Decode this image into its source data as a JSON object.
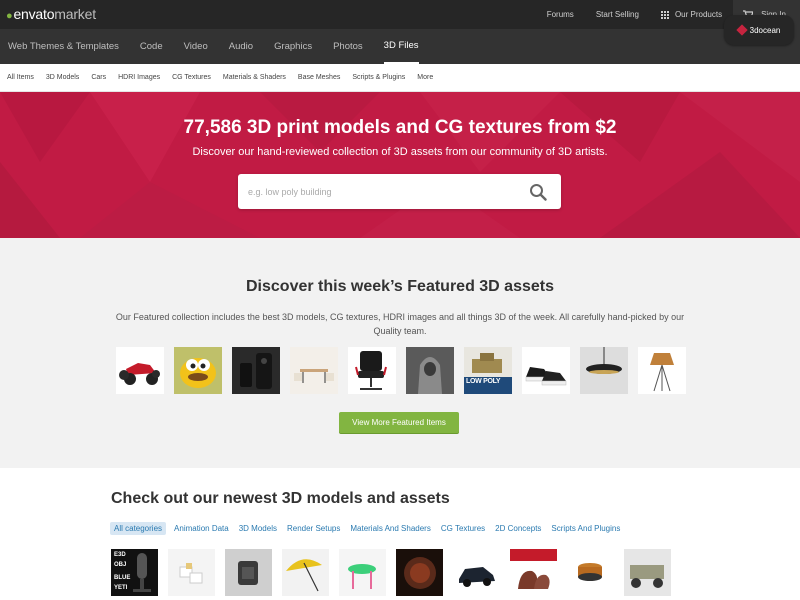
{
  "topbar": {
    "logo_main": "envato",
    "logo_sub": "market",
    "links": [
      "Forums",
      "Start Selling",
      "Our Products",
      "Sign In"
    ]
  },
  "catnav": {
    "items": [
      "Web Themes & Templates",
      "Code",
      "Video",
      "Audio",
      "Graphics",
      "Photos",
      "3D Files"
    ],
    "active": "3D Files",
    "brand": "3docean"
  },
  "subnav": {
    "items": [
      "All Items",
      "3D Models",
      "Cars",
      "HDRI Images",
      "CG Textures",
      "Materials & Shaders",
      "Base Meshes",
      "Scripts & Plugins",
      "More"
    ]
  },
  "hero": {
    "title": "77,586 3D print models and CG textures from $2",
    "subtitle": "Discover our hand-reviewed collection of 3D assets from our community of 3D artists.",
    "search_placeholder": "e.g. low poly building",
    "bg_color": "#c11b44"
  },
  "featured": {
    "title": "Discover this week’s Featured 3D assets",
    "description": "Our Featured collection includes the best 3D models, CG textures, HDRI images and all things 3D of the week. All carefully hand-picked by our Quality team.",
    "thumb_labels": [
      "LOW POLY"
    ],
    "button_label": "View More Featured Items",
    "button_color": "#82b541"
  },
  "newest": {
    "title": "Check out our newest 3D models and assets",
    "filters": [
      "All categories",
      "Animation Data",
      "3D Models",
      "Render Setups",
      "Materials And Shaders",
      "CG Textures",
      "2D Concepts",
      "Scripts And Plugins"
    ],
    "active_filter": "All categories",
    "thumb_text": {
      "first_lines": [
        "E3D",
        "OBJ",
        "BLUE",
        "YETI"
      ]
    }
  }
}
